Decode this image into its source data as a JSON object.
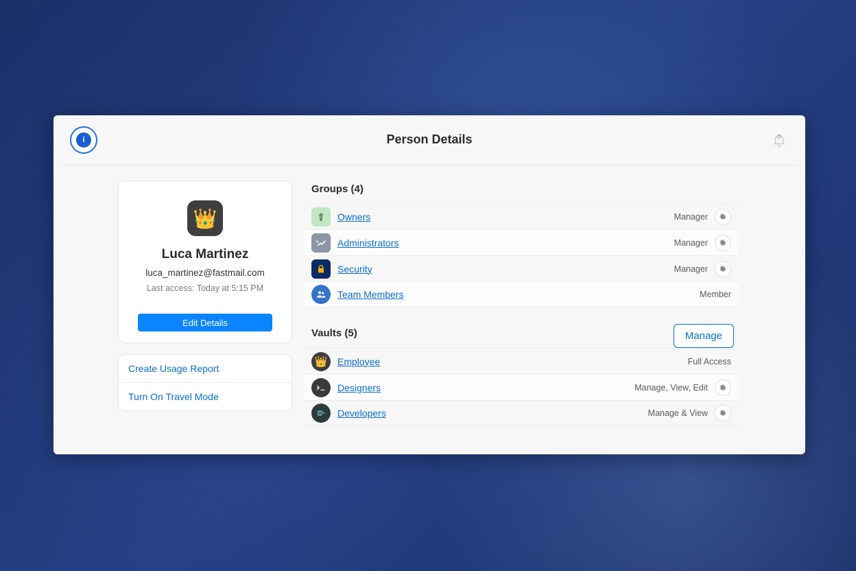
{
  "header": {
    "title": "Person Details",
    "notification_count": "0"
  },
  "person": {
    "name": "Luca Martinez",
    "email": "luca_martinez@fastmail.com",
    "last_access": "Last access: Today at 5:15 PM",
    "edit_button": "Edit Details"
  },
  "actions": {
    "create_report": "Create Usage Report",
    "travel_mode": "Turn On Travel Mode"
  },
  "groups": {
    "title": "Groups (4)",
    "items": [
      {
        "name": "Owners",
        "role": "Manager",
        "has_gear": true
      },
      {
        "name": "Administrators",
        "role": "Manager",
        "has_gear": true
      },
      {
        "name": "Security",
        "role": "Manager",
        "has_gear": true
      },
      {
        "name": "Team Members",
        "role": "Member",
        "has_gear": false
      }
    ]
  },
  "vaults": {
    "title": "Vaults (5)",
    "manage_button": "Manage",
    "items": [
      {
        "name": "Employee",
        "role": "Full Access",
        "has_gear": false
      },
      {
        "name": "Designers",
        "role": "Manage, View, Edit",
        "has_gear": true
      },
      {
        "name": "Developers",
        "role": "Manage & View",
        "has_gear": true
      }
    ]
  }
}
